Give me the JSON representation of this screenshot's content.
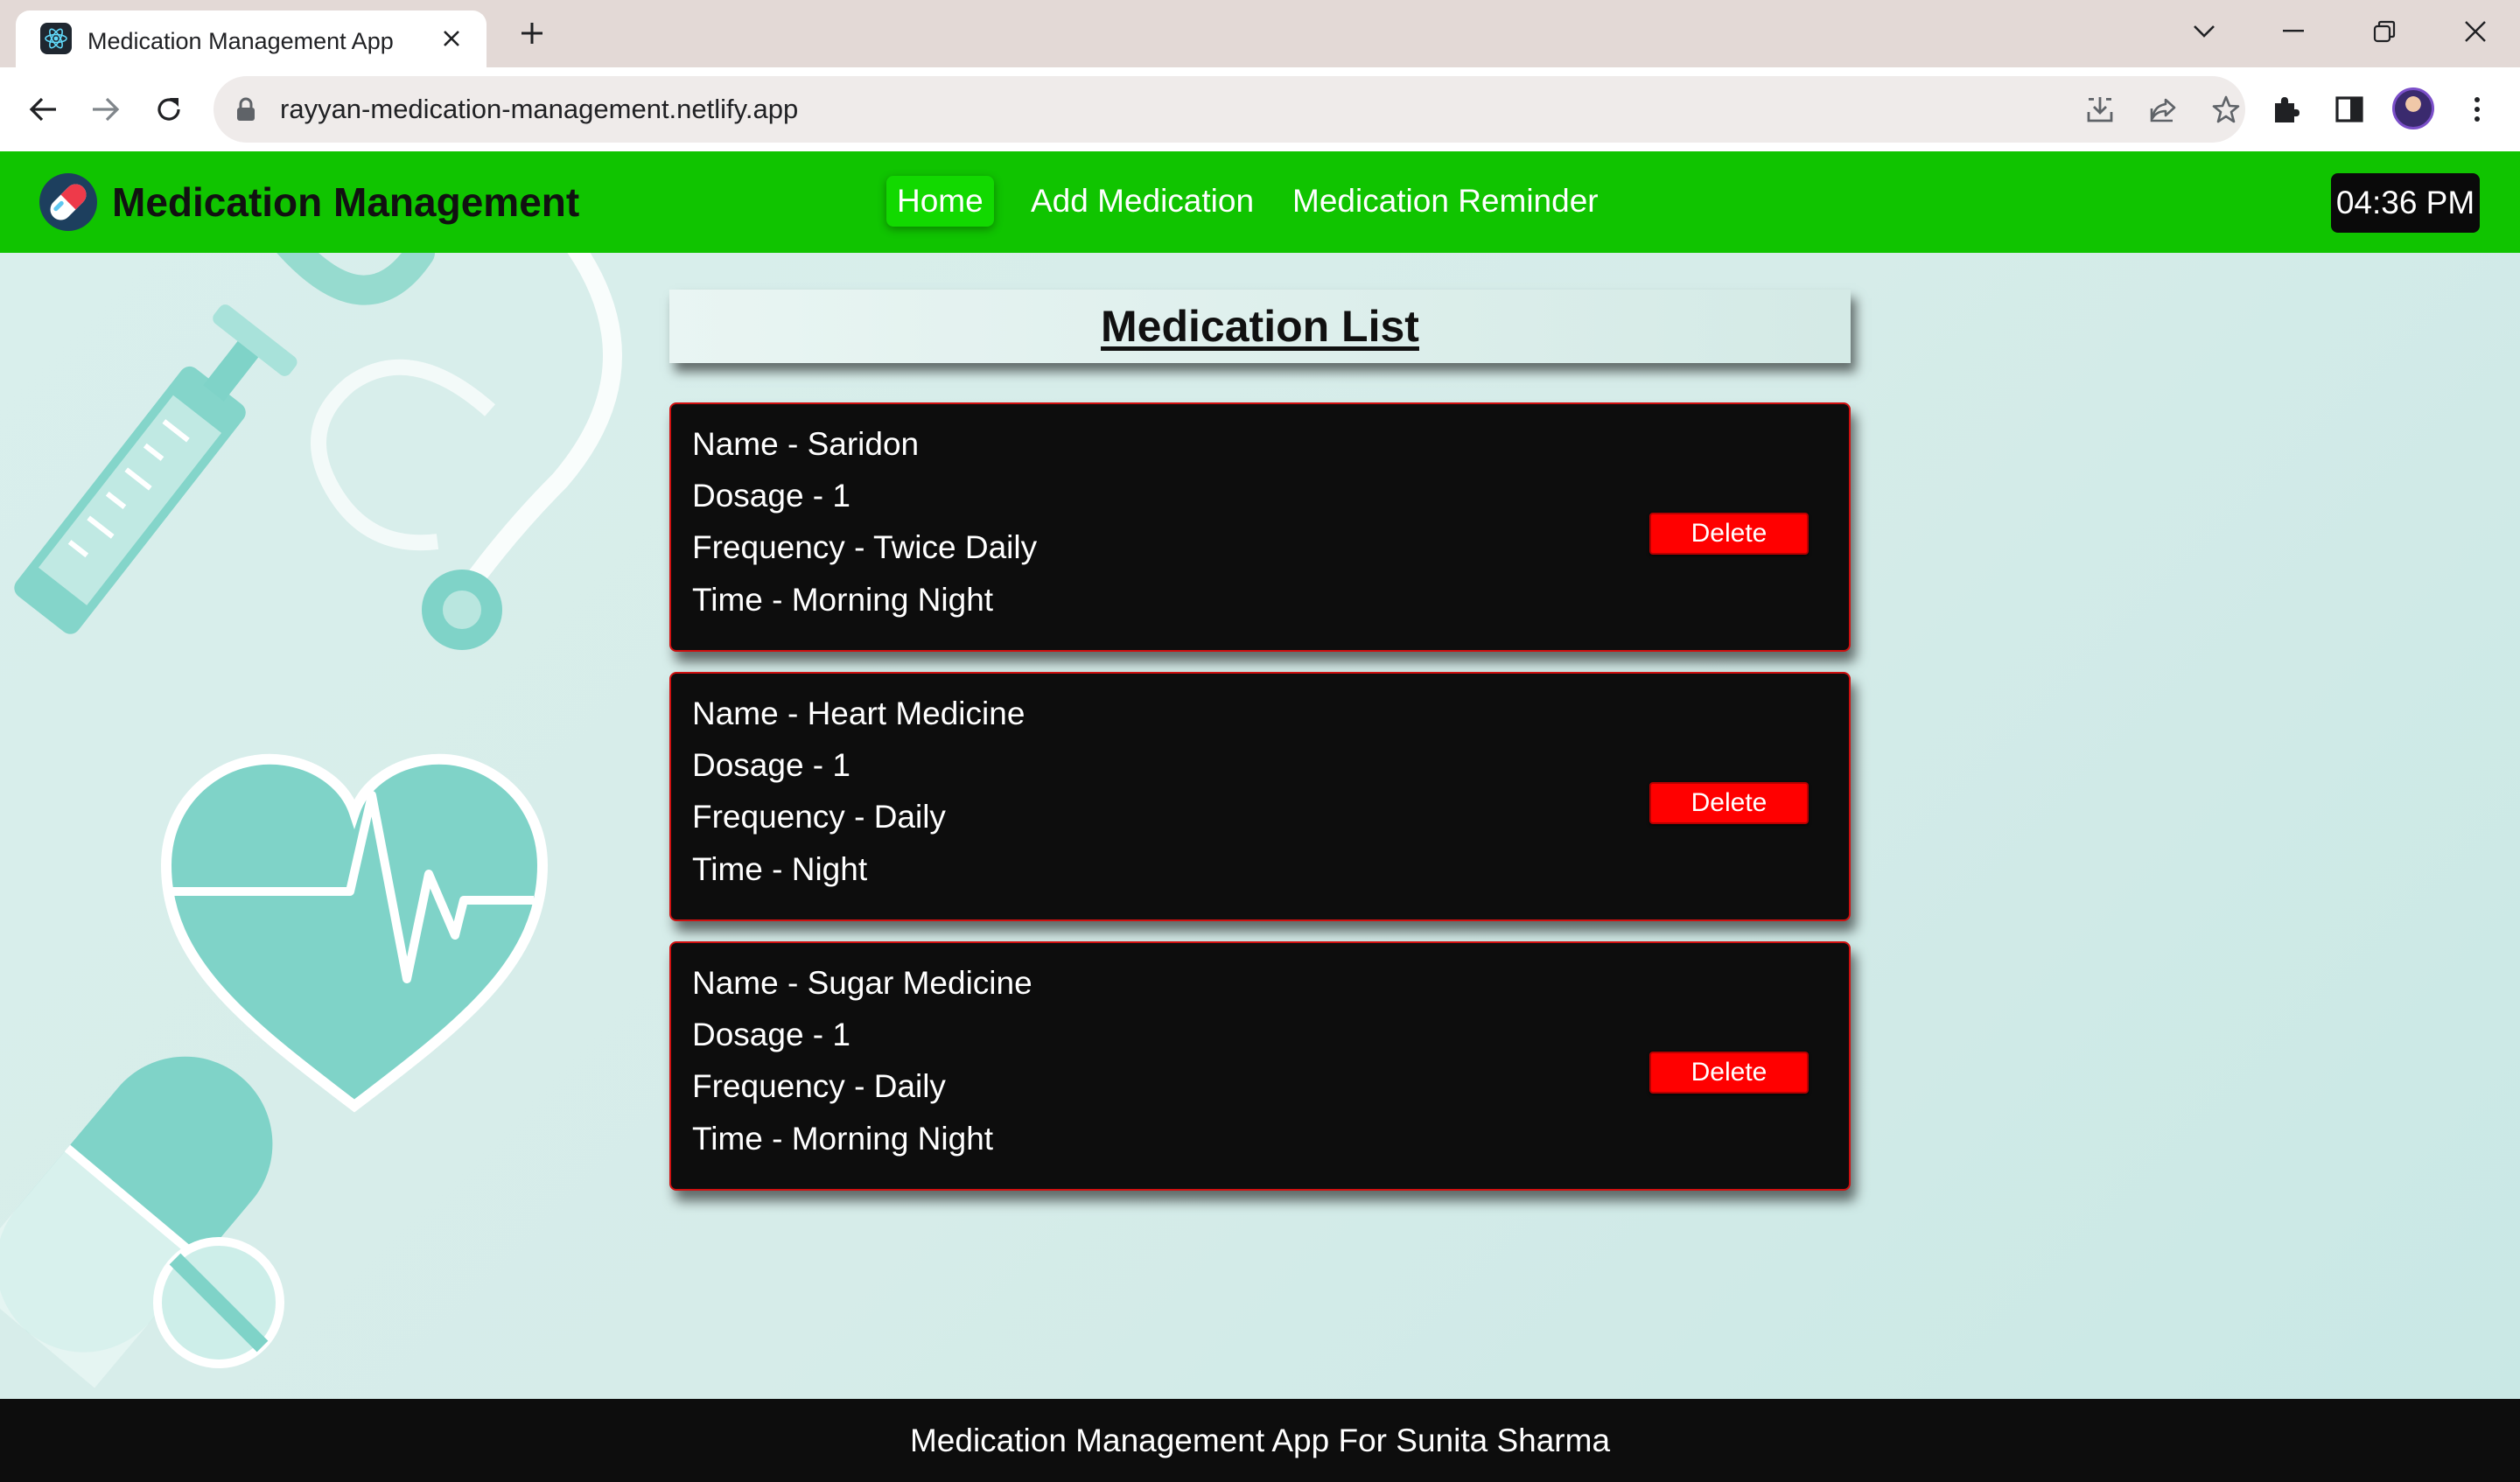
{
  "browser": {
    "tab_title": "Medication Management App",
    "url": "rayyan-medication-management.netlify.app"
  },
  "header": {
    "brand": "Medication Management",
    "nav": [
      {
        "label": "Home",
        "active": true
      },
      {
        "label": "Add Medication",
        "active": false
      },
      {
        "label": "Medication Reminder",
        "active": false
      }
    ],
    "clock": "04:36 PM",
    "colors": {
      "header_bg": "#10c400",
      "active_link_bg": "#12d900"
    }
  },
  "main": {
    "title": "Medication List",
    "medications": [
      {
        "name": "Name - Saridon",
        "dosage": "Dosage - 1",
        "frequency": "Frequency - Twice Daily",
        "time": "Time - Morning Night",
        "delete_label": "Delete"
      },
      {
        "name": "Name - Heart Medicine",
        "dosage": "Dosage - 1",
        "frequency": "Frequency - Daily",
        "time": "Time - Night",
        "delete_label": "Delete"
      },
      {
        "name": "Name - Sugar Medicine",
        "dosage": "Dosage - 1",
        "frequency": "Frequency - Daily",
        "time": "Time - Morning Night",
        "delete_label": "Delete"
      }
    ],
    "colors": {
      "card_bg": "#0d0d0d",
      "card_border": "#d01010",
      "delete_bg": "#ff0000"
    }
  },
  "footer": {
    "text": "Medication Management App For Sunita Sharma"
  }
}
